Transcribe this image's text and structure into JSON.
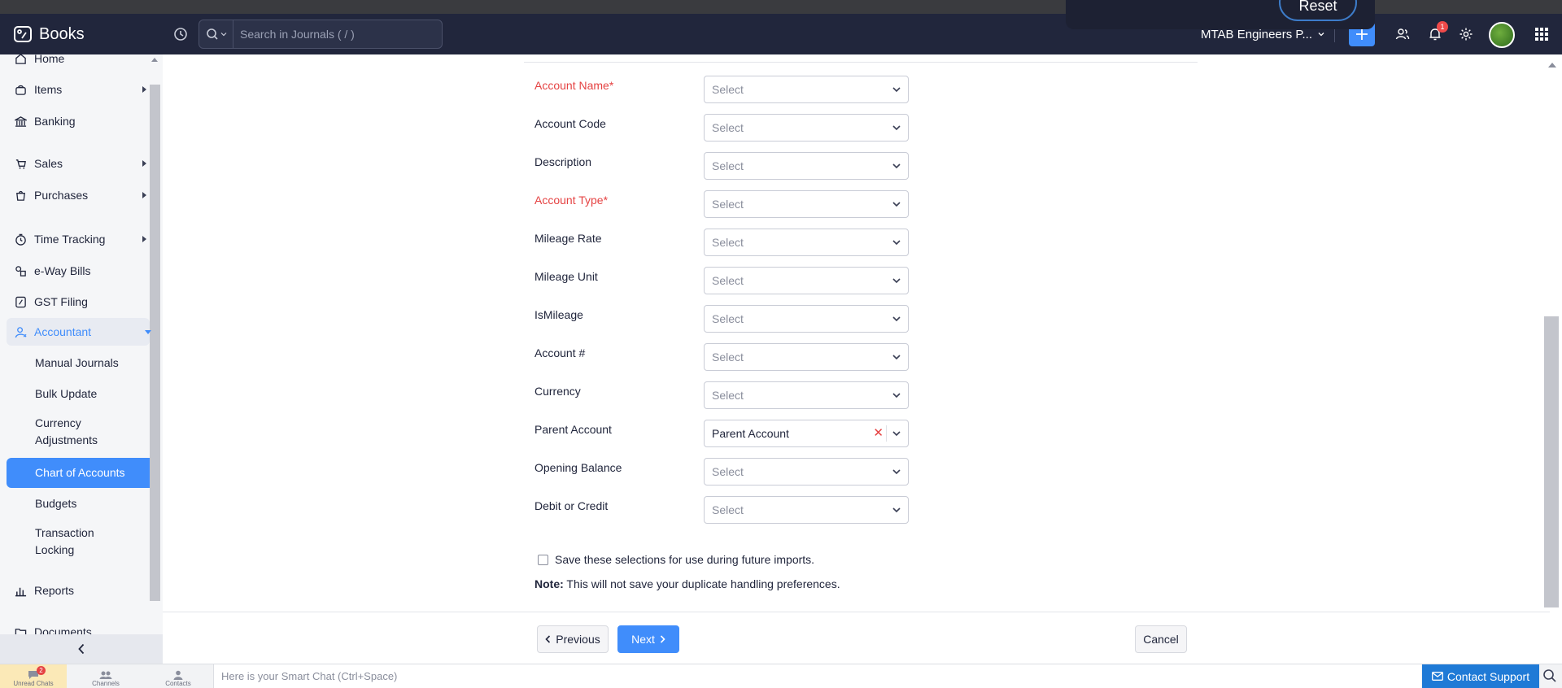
{
  "app": {
    "name": "Books",
    "search_placeholder": "Search in Journals ( / )",
    "org_name": "MTAB Engineers P...",
    "notification_count": "1",
    "toast_button": "Reset"
  },
  "sidebar": {
    "items": [
      {
        "label": "Home",
        "icon": "home-icon"
      },
      {
        "label": "Items",
        "icon": "items-icon"
      },
      {
        "label": "Banking",
        "icon": "bank-icon"
      },
      {
        "label": "Sales",
        "icon": "sales-icon"
      },
      {
        "label": "Purchases",
        "icon": "purchases-icon"
      },
      {
        "label": "Time Tracking",
        "icon": "clock-icon"
      },
      {
        "label": "e-Way Bills",
        "icon": "eway-icon"
      },
      {
        "label": "GST Filing",
        "icon": "gst-icon"
      },
      {
        "label": "Accountant",
        "icon": "accountant-icon"
      },
      {
        "label": "Reports",
        "icon": "reports-icon"
      },
      {
        "label": "Documents",
        "icon": "documents-icon"
      }
    ],
    "accountant_sub": [
      {
        "label": "Manual Journals"
      },
      {
        "label": "Bulk Update"
      },
      {
        "label": "Currency Adjustments"
      },
      {
        "label": "Chart of Accounts"
      },
      {
        "label": "Budgets"
      },
      {
        "label": "Transaction Locking"
      }
    ]
  },
  "form": {
    "fields": [
      {
        "label": "Account Name*",
        "value": "Select",
        "required": true
      },
      {
        "label": "Account Code",
        "value": "Select",
        "required": false
      },
      {
        "label": "Description",
        "value": "Select",
        "required": false
      },
      {
        "label": "Account Type*",
        "value": "Select",
        "required": true
      },
      {
        "label": "Mileage Rate",
        "value": "Select",
        "required": false
      },
      {
        "label": "Mileage Unit",
        "value": "Select",
        "required": false
      },
      {
        "label": "IsMileage",
        "value": "Select",
        "required": false
      },
      {
        "label": "Account #",
        "value": "Select",
        "required": false
      },
      {
        "label": "Currency",
        "value": "Select",
        "required": false
      },
      {
        "label": "Parent Account",
        "value": "Parent Account",
        "required": false
      },
      {
        "label": "Opening Balance",
        "value": "Select",
        "required": false
      },
      {
        "label": "Debit or Credit",
        "value": "Select",
        "required": false
      }
    ],
    "save_selections": "Save these selections for use during future imports.",
    "note_label": "Note:",
    "note_text": " This will not save your duplicate handling preferences."
  },
  "footer": {
    "previous": "Previous",
    "next": "Next",
    "cancel": "Cancel"
  },
  "chatbar": {
    "tabs": [
      {
        "label": "Unread Chats",
        "badge": "2"
      },
      {
        "label": "Channels"
      },
      {
        "label": "Contacts"
      }
    ],
    "placeholder": "Here is your Smart Chat (Ctrl+Space)",
    "contact_support": "Contact Support"
  },
  "colors": {
    "header": "#21263c",
    "accent": "#408dfb",
    "required": "#e54343"
  }
}
